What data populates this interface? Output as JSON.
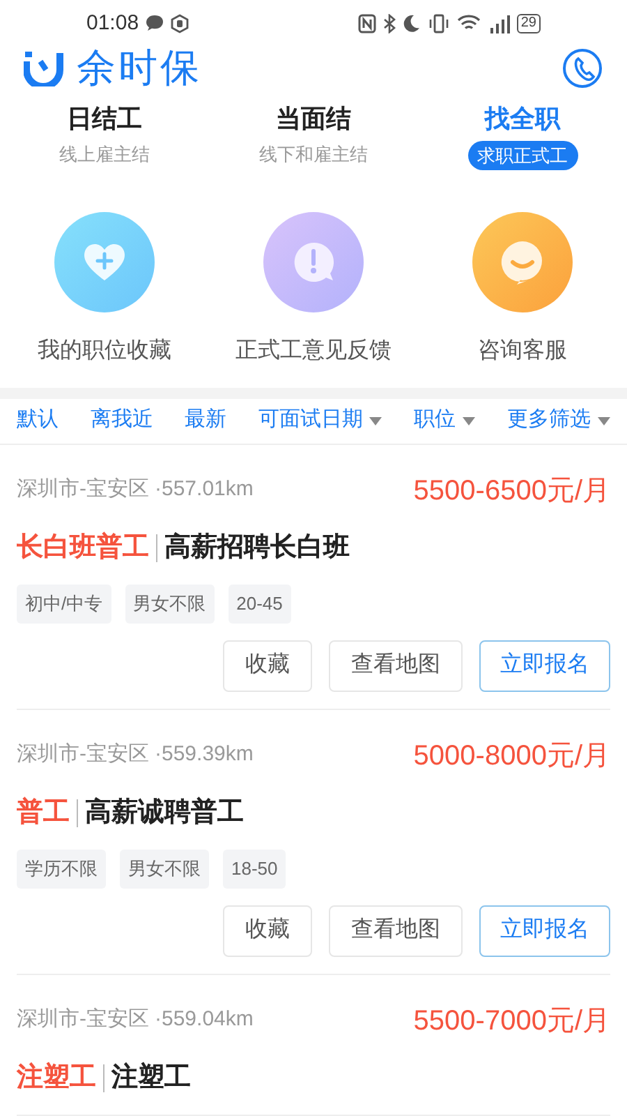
{
  "status_bar": {
    "time": "01:08",
    "battery": "29"
  },
  "header": {
    "logo_text": "余时保"
  },
  "tabs": [
    {
      "title": "日结工",
      "subtitle": "线上雇主结",
      "selected": false
    },
    {
      "title": "当面结",
      "subtitle": "线下和雇主结",
      "selected": false
    },
    {
      "title": "找全职",
      "subtitle": "求职正式工",
      "selected": true
    }
  ],
  "shortcuts": [
    {
      "kind": "favorites",
      "label": "我的职位收藏"
    },
    {
      "kind": "feedback",
      "label": "正式工意见反馈"
    },
    {
      "kind": "service",
      "label": "咨询客服"
    }
  ],
  "filters": [
    {
      "label": "默认",
      "dropdown": false
    },
    {
      "label": "离我近",
      "dropdown": false
    },
    {
      "label": "最新",
      "dropdown": false
    },
    {
      "label": "可面试日期",
      "dropdown": true
    },
    {
      "label": "职位",
      "dropdown": true
    },
    {
      "label": "更多筛选",
      "dropdown": true
    }
  ],
  "jobs": [
    {
      "location": "深圳市-宝安区",
      "distance": "·557.01km",
      "salary": "5500-6500元/月",
      "category": "长白班普工",
      "title": "高薪招聘长白班",
      "tags": [
        "初中/中专",
        "男女不限",
        "20-45"
      ],
      "actions": [
        "收藏",
        "查看地图",
        "立即报名"
      ]
    },
    {
      "location": "深圳市-宝安区",
      "distance": "·559.39km",
      "salary": "5000-8000元/月",
      "category": "普工",
      "title": "高薪诚聘普工",
      "tags": [
        "学历不限",
        "男女不限",
        "18-50"
      ],
      "actions": [
        "收藏",
        "查看地图",
        "立即报名"
      ]
    },
    {
      "location": "深圳市-宝安区",
      "distance": "·559.04km",
      "salary": "5500-7000元/月",
      "category": "注塑工",
      "title": "注塑工"
    }
  ]
}
